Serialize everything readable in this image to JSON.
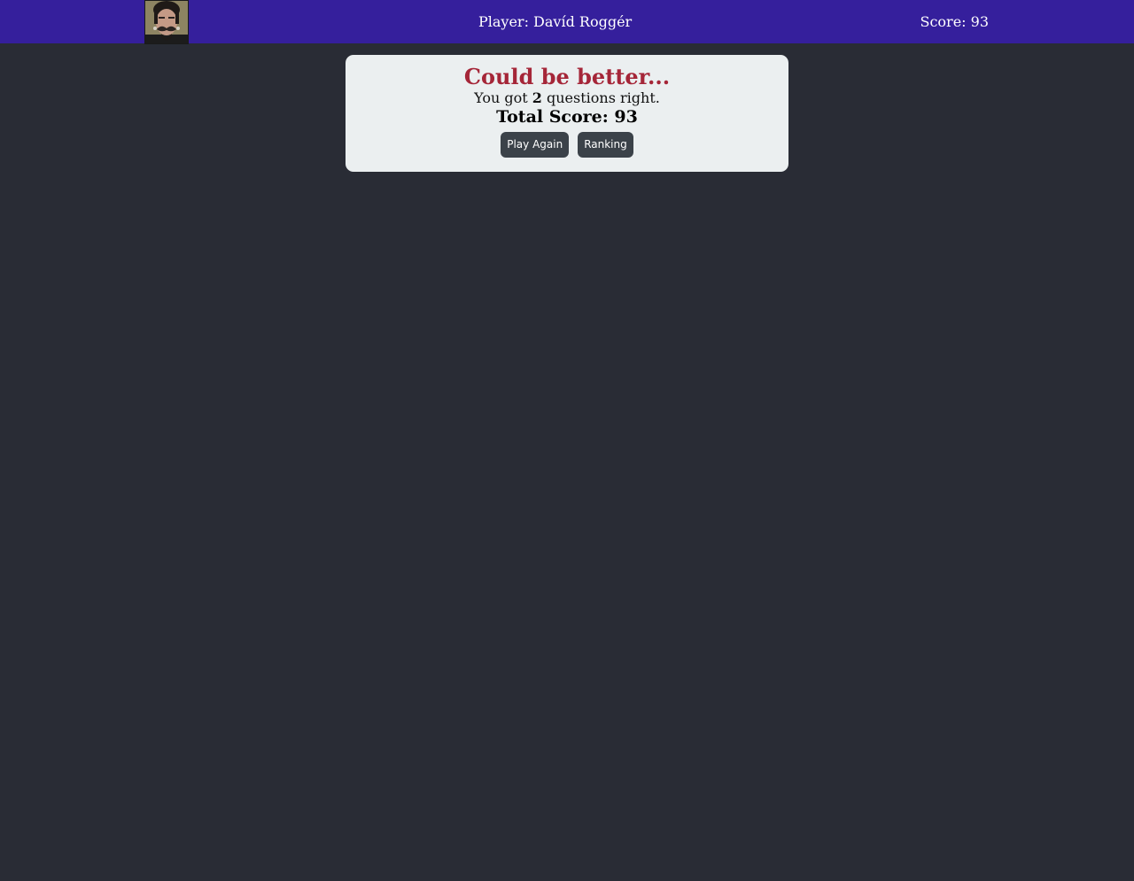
{
  "header": {
    "player_label": "Player: Davíd Roggér",
    "score_label": "Score: 93"
  },
  "result": {
    "title": "Could be better...",
    "line_prefix": "You got ",
    "correct_count": "2",
    "line_suffix": " questions right.",
    "total_score_label": "Total Score: 93"
  },
  "actions": {
    "play_again_label": "Play Again",
    "ranking_label": "Ranking"
  },
  "colors": {
    "header_bg": "#351f9c",
    "page_bg": "#292c35",
    "card_bg": "#ebeff0",
    "title_red": "#a52638",
    "button_bg": "#3b4249"
  }
}
